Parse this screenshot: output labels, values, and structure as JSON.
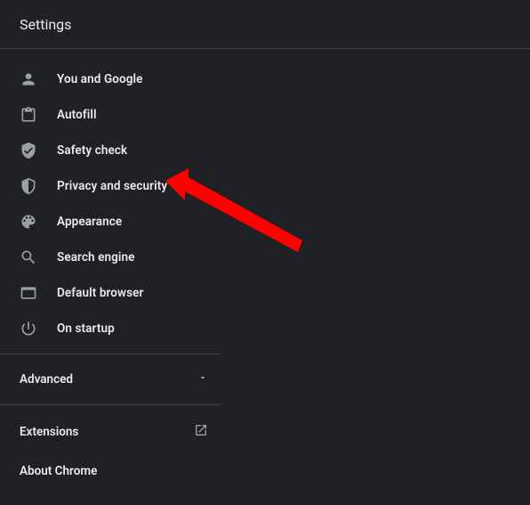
{
  "header": {
    "title": "Settings"
  },
  "sidebar": {
    "items": [
      {
        "label": "You and Google"
      },
      {
        "label": "Autofill"
      },
      {
        "label": "Safety check"
      },
      {
        "label": "Privacy and security"
      },
      {
        "label": "Appearance"
      },
      {
        "label": "Search engine"
      },
      {
        "label": "Default browser"
      },
      {
        "label": "On startup"
      }
    ],
    "advanced_label": "Advanced",
    "extensions_label": "Extensions",
    "about_label": "About Chrome"
  }
}
